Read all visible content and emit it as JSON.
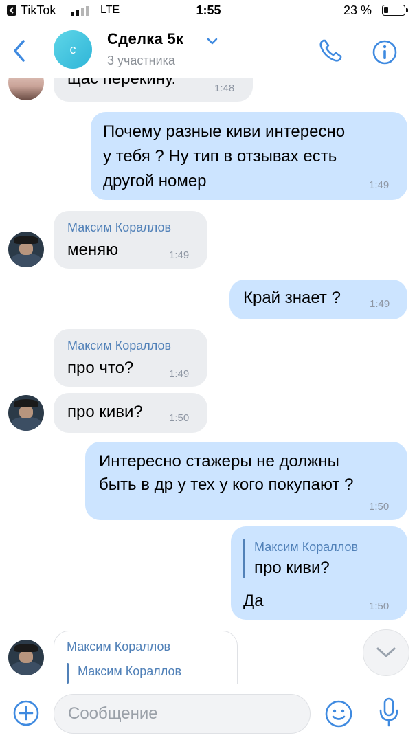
{
  "status_bar": {
    "app_name": "TikTok",
    "carrier": "LTE",
    "time": "1:55",
    "battery": "23 %",
    "battery_level": 0.23
  },
  "header": {
    "avatar_letter": "с",
    "title": "Сделка 5к",
    "subtitle": "3 участника"
  },
  "messages": [
    {
      "id": "m1",
      "direction": "in",
      "text": "щас перекину.",
      "time": "1:48"
    },
    {
      "id": "m2",
      "direction": "out",
      "lines": [
        "Почему разные киви интересно",
        "у тебя ? Ну тип в отзывах есть",
        "другой номер"
      ],
      "time": "1:49"
    },
    {
      "id": "m3",
      "direction": "in",
      "sender": "Максим Кораллов",
      "text": "меняю",
      "time": "1:49"
    },
    {
      "id": "m4",
      "direction": "out",
      "text": "Край знает ?",
      "time": "1:49"
    },
    {
      "id": "m5",
      "direction": "in",
      "sender": "Максим Кораллов",
      "text": "про что?",
      "time": "1:49"
    },
    {
      "id": "m6",
      "direction": "in",
      "text": "про киви?",
      "time": "1:50"
    },
    {
      "id": "m7",
      "direction": "out",
      "lines": [
        "Интересно стажеры не должны",
        "быть в др у тех у кого покупают ?"
      ],
      "time": "1:50"
    },
    {
      "id": "m8",
      "direction": "out",
      "quote_sender": "Максим Кораллов",
      "quote_text": "про киви?",
      "text": "Да",
      "time": "1:50"
    },
    {
      "id": "m9",
      "direction": "in",
      "sender": "Максим Кораллов",
      "quote_sender": "Максим Кораллов"
    }
  ],
  "input": {
    "placeholder": "Сообщение"
  },
  "colors": {
    "accent": "#5181b8",
    "outgoing_bubble": "#cce4ff",
    "incoming_bubble": "#ebedf0"
  },
  "icons": [
    "back-icon",
    "chevron-down-icon",
    "phone-icon",
    "info-icon",
    "plus-icon",
    "smile-icon",
    "mic-icon",
    "scroll-down-icon"
  ]
}
